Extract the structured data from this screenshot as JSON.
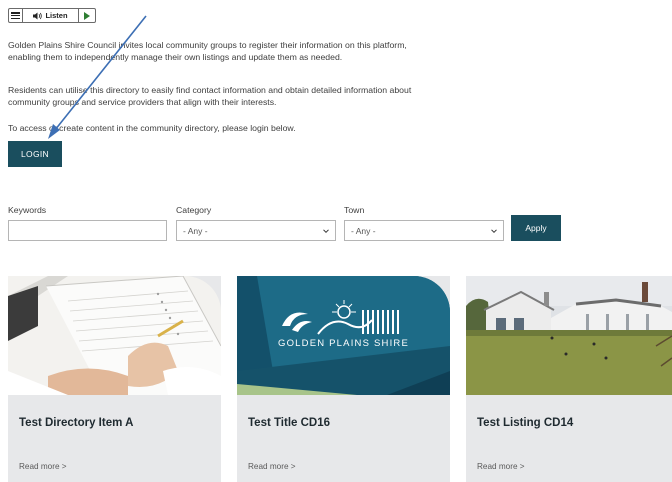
{
  "toolbar": {
    "listen_label": "Listen",
    "icons": [
      "menu-icon",
      "speaker-icon",
      "play-icon"
    ]
  },
  "intro": {
    "p1": "Golden Plains Shire Council invites local community groups to register their information on this platform, enabling them to independently manage their own listings and update them as needed.",
    "p2": "Residents can utilise this directory to easily find contact information and obtain detailed information about community groups and service providers that align with their interests.",
    "p3": "To access or create content in the community directory, please login below."
  },
  "login": {
    "label": "LOGIN"
  },
  "filters": {
    "keywords_label": "Keywords",
    "keywords_value": "",
    "category_label": "Category",
    "category_value": "- Any -",
    "town_label": "Town",
    "town_value": "- Any -",
    "apply_label": "Apply"
  },
  "cards": [
    {
      "title": "Test Directory Item A",
      "link": "Read more >"
    },
    {
      "title": "Test Title CD16",
      "link": "Read more >",
      "logo_text": "GOLDEN PLAINS SHIRE"
    },
    {
      "title": "Test Listing CD14",
      "link": "Read more >"
    }
  ],
  "colors": {
    "primary": "#1a4e5e",
    "card_bg": "#e7e8ea",
    "logo_bg": "#1d6b87",
    "arrow": "#3d6fb4"
  }
}
